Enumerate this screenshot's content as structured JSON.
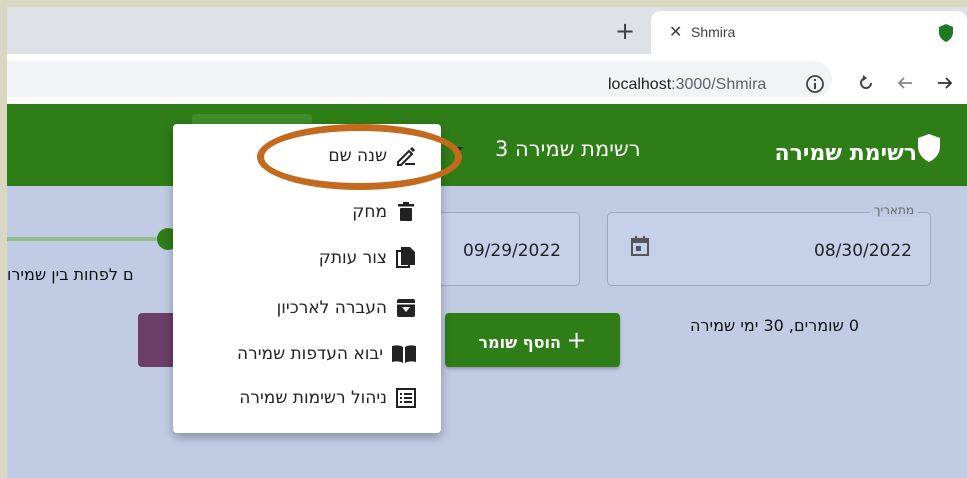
{
  "browser": {
    "tab_title": "Shmira",
    "url_host": "localhost",
    "url_path": ":3000/Shmira"
  },
  "app": {
    "title": "רשימת שמירה",
    "list_name": "רשימת שמירה 3",
    "brand_color": "#2e7d17"
  },
  "form": {
    "from_label": "מתאריך",
    "from_value": "08/30/2022",
    "to_value": "09/29/2022",
    "summary": "0 שומרים, 30 ימי שמירה",
    "add_button": "הוסף שומר",
    "slider_label": "ם לפחות בין שמירו"
  },
  "menu": {
    "items": [
      {
        "label": "שנה שם",
        "icon": "pencil-icon"
      },
      {
        "label": "מחק",
        "icon": "trash-icon"
      },
      {
        "label": "צור עותק",
        "icon": "copy-icon"
      },
      {
        "label": "העברה לארכיון",
        "icon": "archive-icon"
      },
      {
        "label": "יבוא העדפות שמירה",
        "icon": "book-icon"
      },
      {
        "label": "ניהול רשימות שמירה",
        "icon": "list-icon"
      }
    ]
  },
  "annotation_color": "#c46a1f"
}
